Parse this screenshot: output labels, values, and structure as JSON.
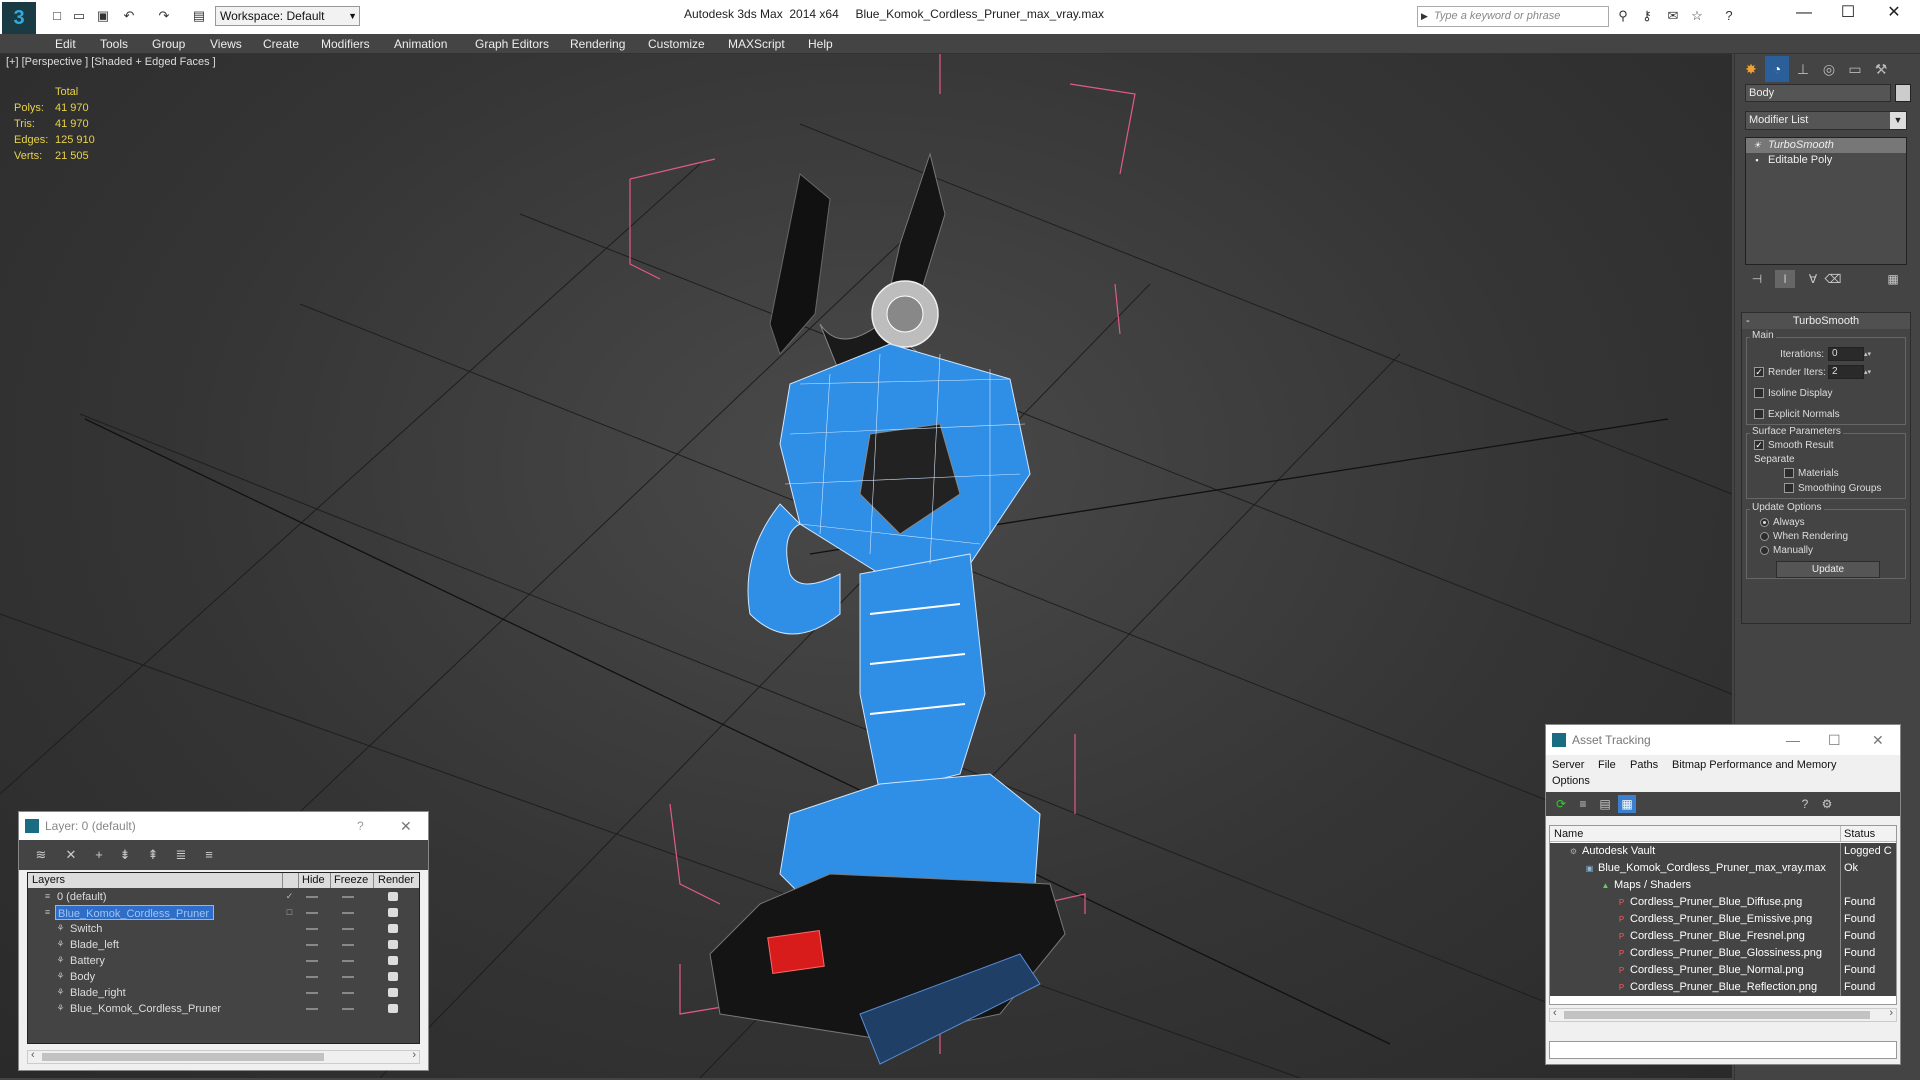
{
  "titlebar": {
    "app": "Autodesk 3ds Max  2014 x64",
    "file": "Blue_Komok_Cordless_Pruner_max_vray.max",
    "workspace": "Workspace: Default",
    "search_placeholder": "Type a keyword or phrase"
  },
  "menu": [
    "Edit",
    "Tools",
    "Group",
    "Views",
    "Create",
    "Modifiers",
    "Animation",
    "Graph Editors",
    "Rendering",
    "Customize",
    "MAXScript",
    "Help"
  ],
  "viewport": {
    "label": "[+] [Perspective ] [Shaded + Edged Faces ]",
    "stats": {
      "header": "Total",
      "rows": [
        {
          "label": "Polys:",
          "value": "41 970"
        },
        {
          "label": "Tris:",
          "value": "41 970"
        },
        {
          "label": "Edges:",
          "value": "125 910"
        },
        {
          "label": "Verts:",
          "value": "21 505"
        }
      ]
    }
  },
  "command_panel": {
    "object_name": "Body",
    "modifier_list": "Modifier List",
    "stack": [
      "TurboSmooth",
      "Editable Poly"
    ],
    "rollout_title": "TurboSmooth",
    "main_label": "Main",
    "iterations_label": "Iterations:",
    "iterations_value": "0",
    "render_iters_label": "Render Iters:",
    "render_iters_value": "2",
    "isoline": "Isoline Display",
    "explicit_normals": "Explicit Normals",
    "surface_params": "Surface Parameters",
    "smooth_result": "Smooth Result",
    "separate": "Separate",
    "materials": "Materials",
    "smoothing_groups": "Smoothing Groups",
    "update_options": "Update Options",
    "always": "Always",
    "when_rendering": "When Rendering",
    "manually": "Manually",
    "update_button": "Update"
  },
  "layer_dialog": {
    "title": "Layer: 0 (default)",
    "help": "?",
    "columns": [
      "Layers",
      "Hide",
      "Freeze",
      "Render"
    ],
    "rows": [
      {
        "name": "0 (default)",
        "level": 0,
        "icon": "layer",
        "checked": true,
        "selected": false
      },
      {
        "name": "Blue_Komok_Cordless_Pruner",
        "level": 0,
        "icon": "layer",
        "checked": false,
        "selected": true
      },
      {
        "name": "Switch",
        "level": 1,
        "icon": "object",
        "checked": false,
        "selected": false
      },
      {
        "name": "Blade_left",
        "level": 1,
        "icon": "object",
        "checked": false,
        "selected": false
      },
      {
        "name": "Battery",
        "level": 1,
        "icon": "object",
        "checked": false,
        "selected": false
      },
      {
        "name": "Body",
        "level": 1,
        "icon": "object",
        "checked": false,
        "selected": false
      },
      {
        "name": "Blade_right",
        "level": 1,
        "icon": "object",
        "checked": false,
        "selected": false
      },
      {
        "name": "Blue_Komok_Cordless_Pruner",
        "level": 1,
        "icon": "object",
        "checked": false,
        "selected": false
      }
    ]
  },
  "asset_dialog": {
    "title": "Asset Tracking",
    "menu": [
      "Server",
      "File",
      "Paths",
      "Bitmap Performance and Memory",
      "Options"
    ],
    "columns": [
      "Name",
      "Status"
    ],
    "rows": [
      {
        "name": "Autodesk Vault",
        "status": "Logged C",
        "level": 0,
        "icon": "vault"
      },
      {
        "name": "Blue_Komok_Cordless_Pruner_max_vray.max",
        "status": "Ok",
        "level": 1,
        "icon": "maxfile"
      },
      {
        "name": "Maps / Shaders",
        "status": "",
        "level": 2,
        "icon": "maps"
      },
      {
        "name": "Cordless_Pruner_Blue_Diffuse.png",
        "status": "Found",
        "level": 3,
        "icon": "png"
      },
      {
        "name": "Cordless_Pruner_Blue_Emissive.png",
        "status": "Found",
        "level": 3,
        "icon": "png"
      },
      {
        "name": "Cordless_Pruner_Blue_Fresnel.png",
        "status": "Found",
        "level": 3,
        "icon": "png"
      },
      {
        "name": "Cordless_Pruner_Blue_Glossiness.png",
        "status": "Found",
        "level": 3,
        "icon": "png"
      },
      {
        "name": "Cordless_Pruner_Blue_Normal.png",
        "status": "Found",
        "level": 3,
        "icon": "png"
      },
      {
        "name": "Cordless_Pruner_Blue_Reflection.png",
        "status": "Found",
        "level": 3,
        "icon": "png"
      }
    ]
  },
  "colors": {
    "stats_yellow": "#e7d24a",
    "model_blue": "#2f8fe6",
    "selection_blue": "#2f6ec8",
    "bbox_pink": "#e05a8a"
  }
}
